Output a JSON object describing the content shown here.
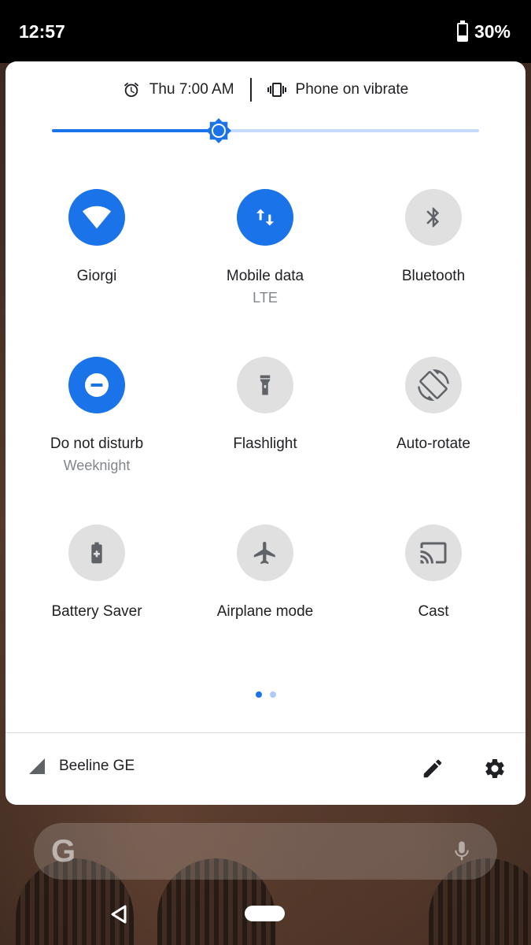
{
  "status_bar": {
    "time": "12:57",
    "battery_percent": "30%",
    "battery_level": 0.3
  },
  "info_row": {
    "alarm_text": "Thu 7:00 AM",
    "ringer_text": "Phone on vibrate"
  },
  "brightness": {
    "level": 0.39
  },
  "tiles": [
    {
      "label": "Giorgi",
      "sub": "",
      "icon": "wifi-icon",
      "on": true
    },
    {
      "label": "Mobile data",
      "sub": "LTE",
      "icon": "mobile-data-icon",
      "on": true
    },
    {
      "label": "Bluetooth",
      "sub": "",
      "icon": "bluetooth-icon",
      "on": false
    },
    {
      "label": "Do not disturb",
      "sub": "Weeknight",
      "icon": "do-not-disturb-icon",
      "on": true
    },
    {
      "label": "Flashlight",
      "sub": "",
      "icon": "flashlight-icon",
      "on": false
    },
    {
      "label": "Auto-rotate",
      "sub": "",
      "icon": "auto-rotate-icon",
      "on": false
    },
    {
      "label": "Battery Saver",
      "sub": "",
      "icon": "battery-saver-icon",
      "on": false
    },
    {
      "label": "Airplane mode",
      "sub": "",
      "icon": "airplane-icon",
      "on": false
    },
    {
      "label": "Cast",
      "sub": "",
      "icon": "cast-icon",
      "on": false
    }
  ],
  "pager": {
    "pages": 2,
    "current": 1
  },
  "footer": {
    "carrier": "Beeline GE"
  },
  "colors": {
    "accent": "#1a73e8",
    "tile_off": "#e0e0e0",
    "text": "#202124",
    "subtext": "#80868b"
  }
}
